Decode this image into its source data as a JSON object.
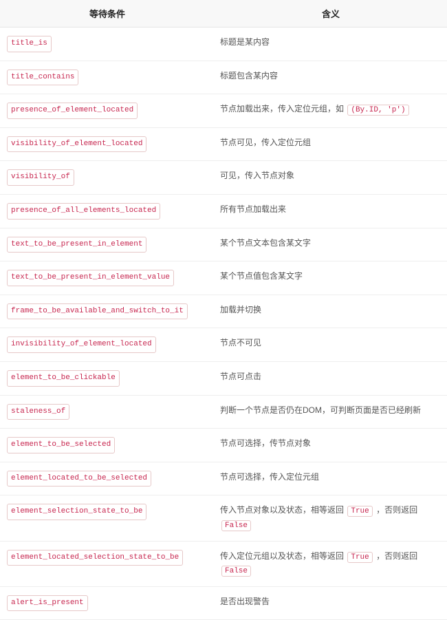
{
  "headers": {
    "condition": "等待条件",
    "meaning": "含义"
  },
  "rows": [
    {
      "condition": "title_is",
      "meaning_parts": [
        {
          "t": "text",
          "v": "标题是某内容"
        }
      ]
    },
    {
      "condition": "title_contains",
      "meaning_parts": [
        {
          "t": "text",
          "v": "标题包含某内容"
        }
      ]
    },
    {
      "condition": "presence_of_element_located",
      "meaning_parts": [
        {
          "t": "text",
          "v": "节点加载出来，传入定位元组，如 "
        },
        {
          "t": "code",
          "v": "(By.ID, 'p')"
        }
      ]
    },
    {
      "condition": "visibility_of_element_located",
      "meaning_parts": [
        {
          "t": "text",
          "v": "节点可见，传入定位元组"
        }
      ]
    },
    {
      "condition": "visibility_of",
      "meaning_parts": [
        {
          "t": "text",
          "v": "可见，传入节点对象"
        }
      ]
    },
    {
      "condition": "presence_of_all_elements_located",
      "meaning_parts": [
        {
          "t": "text",
          "v": "所有节点加载出来"
        }
      ]
    },
    {
      "condition": "text_to_be_present_in_element",
      "meaning_parts": [
        {
          "t": "text",
          "v": "某个节点文本包含某文字"
        }
      ]
    },
    {
      "condition": "text_to_be_present_in_element_value",
      "meaning_parts": [
        {
          "t": "text",
          "v": "某个节点值包含某文字"
        }
      ]
    },
    {
      "condition": "frame_to_be_available_and_switch_to_it",
      "meaning_parts": [
        {
          "t": "text",
          "v": "加载并切换"
        }
      ]
    },
    {
      "condition": "invisibility_of_element_located",
      "meaning_parts": [
        {
          "t": "text",
          "v": "节点不可见"
        }
      ]
    },
    {
      "condition": "element_to_be_clickable",
      "meaning_parts": [
        {
          "t": "text",
          "v": "节点可点击"
        }
      ]
    },
    {
      "condition": "staleness_of",
      "meaning_parts": [
        {
          "t": "text",
          "v": "判断一个节点是否仍在DOM，可判断页面是否已经刷新"
        }
      ]
    },
    {
      "condition": "element_to_be_selected",
      "meaning_parts": [
        {
          "t": "text",
          "v": "节点可选择，传节点对象"
        }
      ]
    },
    {
      "condition": "element_located_to_be_selected",
      "meaning_parts": [
        {
          "t": "text",
          "v": "节点可选择，传入定位元组"
        }
      ]
    },
    {
      "condition": "element_selection_state_to_be",
      "meaning_parts": [
        {
          "t": "text",
          "v": "传入节点对象以及状态，相等返回 "
        },
        {
          "t": "code",
          "v": "True"
        },
        {
          "t": "text",
          "v": " ，否则返回 "
        },
        {
          "t": "code",
          "v": "False"
        }
      ]
    },
    {
      "condition": "element_located_selection_state_to_be",
      "meaning_parts": [
        {
          "t": "text",
          "v": "传入定位元组以及状态，相等返回 "
        },
        {
          "t": "code",
          "v": "True"
        },
        {
          "t": "text",
          "v": " ，否则返回 "
        },
        {
          "t": "code",
          "v": "False"
        }
      ]
    },
    {
      "condition": "alert_is_present",
      "meaning_parts": [
        {
          "t": "text",
          "v": "是否出现警告"
        }
      ]
    }
  ]
}
